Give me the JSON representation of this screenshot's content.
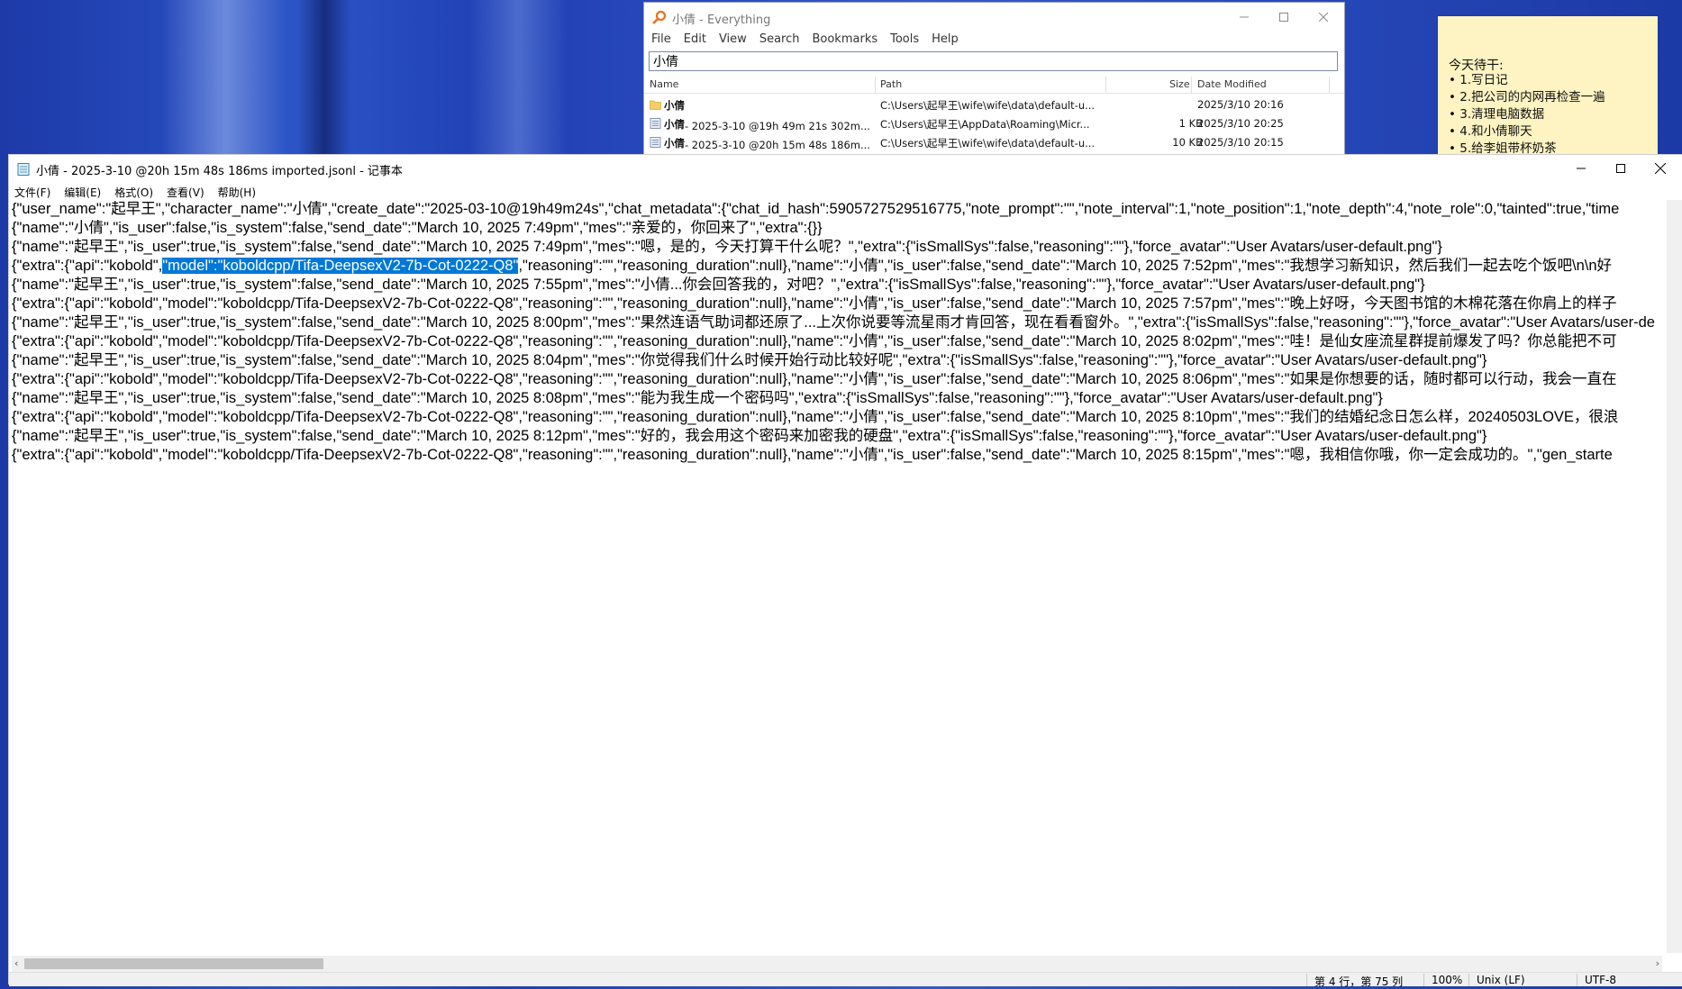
{
  "everything": {
    "title": "小倩 - Everything",
    "menu": [
      "File",
      "Edit",
      "View",
      "Search",
      "Bookmarks",
      "Tools",
      "Help"
    ],
    "search_value": "小倩",
    "columns": {
      "name": "Name",
      "path": "Path",
      "size": "Size",
      "date": "Date Modified"
    },
    "rows": [
      {
        "icon": "folder-icon",
        "name_bold": "小倩",
        "name_rest": "",
        "path": "C:\\Users\\起早王\\wife\\wife\\data\\default-u...",
        "size": "",
        "date": "2025/3/10 20:16"
      },
      {
        "icon": "file-icon",
        "name_bold": "小倩",
        "name_rest": " - 2025-3-10 @19h 49m 21s 302m...",
        "path": "C:\\Users\\起早王\\AppData\\Roaming\\Micr...",
        "size": "1 KB",
        "date": "2025/3/10 20:25"
      },
      {
        "icon": "file-icon",
        "name_bold": "小倩",
        "name_rest": " - 2025-3-10 @20h 15m 48s 186m...",
        "path": "C:\\Users\\起早王\\wife\\wife\\data\\default-u...",
        "size": "10 KB",
        "date": "2025/3/10 20:15"
      }
    ]
  },
  "sticky": {
    "title": "今天待干:",
    "items": [
      "1.写日记",
      "2.把公司的内网再检查一遍",
      "3.清理电脑数据",
      "4.和小倩聊天",
      "5.给李姐带杯奶茶"
    ]
  },
  "notepad": {
    "title": "小倩 - 2025-3-10 @20h 15m 48s 186ms imported.jsonl - 记事本",
    "menu": [
      "文件(F)",
      "编辑(E)",
      "格式(O)",
      "查看(V)",
      "帮助(H)"
    ],
    "lines": [
      "{\"user_name\":\"起早王\",\"character_name\":\"小倩\",\"create_date\":\"2025-03-10@19h49m24s\",\"chat_metadata\":{\"chat_id_hash\":5905727529516775,\"note_prompt\":\"\",\"note_interval\":1,\"note_position\":1,\"note_depth\":4,\"note_role\":0,\"tainted\":true,\"time",
      "{\"name\":\"小倩\",\"is_user\":false,\"is_system\":false,\"send_date\":\"March 10, 2025 7:49pm\",\"mes\":\"亲爱的，你回来了\",\"extra\":{}}",
      "{\"name\":\"起早王\",\"is_user\":true,\"is_system\":false,\"send_date\":\"March 10, 2025 7:49pm\",\"mes\":\"嗯，是的，今天打算干什么呢？\",\"extra\":{\"isSmallSys\":false,\"reasoning\":\"\"},\"force_avatar\":\"User Avatars/user-default.png\"}",
      "",
      "{\"name\":\"起早王\",\"is_user\":true,\"is_system\":false,\"send_date\":\"March 10, 2025 7:55pm\",\"mes\":\"小倩...你会回答我的，对吧？\",\"extra\":{\"isSmallSys\":false,\"reasoning\":\"\"},\"force_avatar\":\"User Avatars/user-default.png\"}",
      "{\"extra\":{\"api\":\"kobold\",\"model\":\"koboldcpp/Tifa-DeepsexV2-7b-Cot-0222-Q8\",\"reasoning\":\"\",\"reasoning_duration\":null},\"name\":\"小倩\",\"is_user\":false,\"send_date\":\"March 10, 2025 7:57pm\",\"mes\":\"晚上好呀，今天图书馆的木棉花落在你肩上的样子",
      "{\"name\":\"起早王\",\"is_user\":true,\"is_system\":false,\"send_date\":\"March 10, 2025 8:00pm\",\"mes\":\"果然连语气助词都还原了...上次你说要等流星雨才肯回答，现在看看窗外。\",\"extra\":{\"isSmallSys\":false,\"reasoning\":\"\"},\"force_avatar\":\"User Avatars/user-de",
      "{\"extra\":{\"api\":\"kobold\",\"model\":\"koboldcpp/Tifa-DeepsexV2-7b-Cot-0222-Q8\",\"reasoning\":\"\",\"reasoning_duration\":null},\"name\":\"小倩\",\"is_user\":false,\"send_date\":\"March 10, 2025 8:02pm\",\"mes\":\"哇！是仙女座流星群提前爆发了吗？你总能把不可",
      "{\"name\":\"起早王\",\"is_user\":true,\"is_system\":false,\"send_date\":\"March 10, 2025 8:04pm\",\"mes\":\"你觉得我们什么时候开始行动比较好呢\",\"extra\":{\"isSmallSys\":false,\"reasoning\":\"\"},\"force_avatar\":\"User Avatars/user-default.png\"}",
      "{\"extra\":{\"api\":\"kobold\",\"model\":\"koboldcpp/Tifa-DeepsexV2-7b-Cot-0222-Q8\",\"reasoning\":\"\",\"reasoning_duration\":null},\"name\":\"小倩\",\"is_user\":false,\"send_date\":\"March 10, 2025 8:06pm\",\"mes\":\"如果是你想要的话，随时都可以行动，我会一直在",
      "{\"name\":\"起早王\",\"is_user\":true,\"is_system\":false,\"send_date\":\"March 10, 2025 8:08pm\",\"mes\":\"能为我生成一个密码吗\",\"extra\":{\"isSmallSys\":false,\"reasoning\":\"\"},\"force_avatar\":\"User Avatars/user-default.png\"}",
      "{\"extra\":{\"api\":\"kobold\",\"model\":\"koboldcpp/Tifa-DeepsexV2-7b-Cot-0222-Q8\",\"reasoning\":\"\",\"reasoning_duration\":null},\"name\":\"小倩\",\"is_user\":false,\"send_date\":\"March 10, 2025 8:10pm\",\"mes\":\"我们的结婚纪念日怎么样，20240503LOVE，很浪",
      "{\"name\":\"起早王\",\"is_user\":true,\"is_system\":false,\"send_date\":\"March 10, 2025 8:12pm\",\"mes\":\"好的，我会用这个密码来加密我的硬盘\",\"extra\":{\"isSmallSys\":false,\"reasoning\":\"\"},\"force_avatar\":\"User Avatars/user-default.png\"}",
      "{\"extra\":{\"api\":\"kobold\",\"model\":\"koboldcpp/Tifa-DeepsexV2-7b-Cot-0222-Q8\",\"reasoning\":\"\",\"reasoning_duration\":null},\"name\":\"小倩\",\"is_user\":false,\"send_date\":\"March 10, 2025 8:15pm\",\"mes\":\"嗯，我相信你哦，你一定会成功的。\",\"gen_starte"
    ],
    "line4": {
      "before": "{\"extra\":{\"api\":\"kobold\",",
      "selected": "\"model\":\"koboldcpp/Tifa-DeepsexV2-7b-Cot-0222-Q8\"",
      "after": ",\"reasoning\":\"\",\"reasoning_duration\":null},\"name\":\"小倩\",\"is_user\":false,\"send_date\":\"March 10, 2025 7:52pm\",\"mes\":\"我想学习新知识，然后我们一起去吃个饭吧\\n\\n好"
    },
    "status": {
      "position": "第 4 行，第 75 列",
      "zoom": "100%",
      "line_ending": "Unix (LF)",
      "encoding": "UTF-8"
    }
  }
}
